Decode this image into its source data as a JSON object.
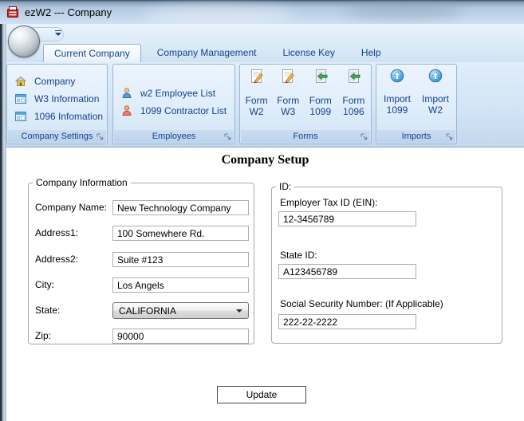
{
  "window": {
    "title": "ezW2 --- Company"
  },
  "tabs": [
    {
      "label": "Current Company",
      "active": true
    },
    {
      "label": "Company Management",
      "active": false
    },
    {
      "label": "License Key",
      "active": false
    },
    {
      "label": "Help",
      "active": false
    }
  ],
  "ribbon": {
    "groups": [
      {
        "caption": "Company Settings",
        "items": [
          {
            "label": "Company",
            "icon": "home-icon"
          },
          {
            "label": "W3 Information",
            "icon": "form-window-icon"
          },
          {
            "label": "1096 Infomation",
            "icon": "form-window-icon"
          }
        ]
      },
      {
        "caption": "Employees",
        "items": [
          {
            "label": "w2 Employee List",
            "icon": "person-blue-icon"
          },
          {
            "label": "1099 Contractor List",
            "icon": "person-red-icon"
          }
        ]
      },
      {
        "caption": "Forms",
        "items": [
          {
            "label": "Form W2",
            "icon": "form-edit-icon"
          },
          {
            "label": "Form W3",
            "icon": "form-edit-icon"
          },
          {
            "label": "Form 1099",
            "icon": "form-insert-icon"
          },
          {
            "label": "Form 1096",
            "icon": "form-insert-icon"
          }
        ]
      },
      {
        "caption": "Imports",
        "items": [
          {
            "label": "Import 1099",
            "icon": "import-up-icon"
          },
          {
            "label": "Import W2",
            "icon": "import-up-icon"
          }
        ]
      }
    ]
  },
  "main": {
    "title": "Company Setup",
    "company_info": {
      "legend": "Company Information",
      "company_name": {
        "label": "Company Name:",
        "value": "New Technology Company"
      },
      "address1": {
        "label": "Address1:",
        "value": "100 Somewhere Rd."
      },
      "address2": {
        "label": "Address2:",
        "value": "Suite #123"
      },
      "city": {
        "label": "City:",
        "value": "Los Angels"
      },
      "state": {
        "label": "State:",
        "value": "CALIFORNIA"
      },
      "zip": {
        "label": "Zip:",
        "value": "90000"
      }
    },
    "id_info": {
      "legend": "ID:",
      "ein": {
        "label": "Employer Tax ID (EIN):",
        "value": "12-3456789"
      },
      "state_id": {
        "label": "State ID:",
        "value": "A123456789"
      },
      "ssn": {
        "label": "Social Security Number: (If Applicable)",
        "value": "222-22-2222"
      }
    },
    "update_button": "Update"
  },
  "colors": {
    "accent_text": "#15428b",
    "ribbon_border": "#9ab5d3",
    "app_icon_red": "#cc1f1f",
    "content_bg": "#ffffff"
  }
}
